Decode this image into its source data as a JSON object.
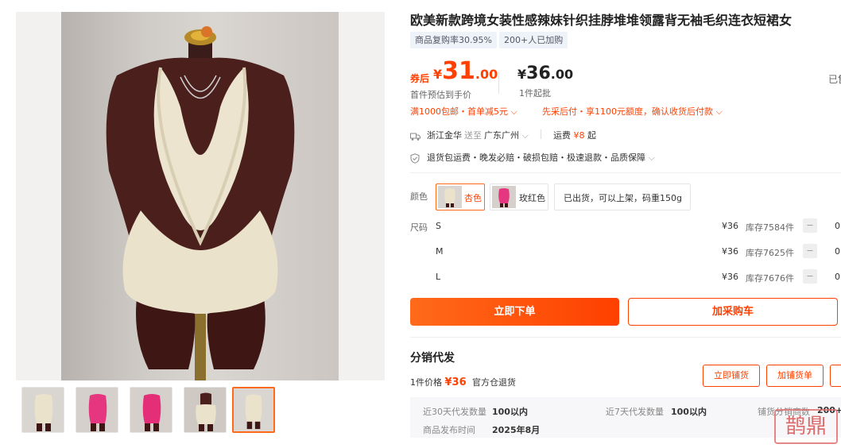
{
  "product": {
    "title": "欧美新款跨境女装性感辣妹针织挂脖堆堆领露背无袖毛织连衣短裙女",
    "tags": [
      "商品复购率30.95%",
      "200+人已加购"
    ]
  },
  "price": {
    "coupon_label": "券后",
    "coupon_sym": "¥",
    "coupon_int": "31",
    "coupon_dec": ".00",
    "coupon_note": "首件预估到手价",
    "base_sym": "¥",
    "base_int": "36",
    "base_dec": ".00",
    "base_note": "1件起批",
    "right_edge_text": "已售"
  },
  "promos": {
    "left": "满1000包邮・首单减5元",
    "right": "先采后付・享1100元额度，确认收货后付款"
  },
  "shipping": {
    "from": "浙江金华",
    "to_label": "送至",
    "to": "广东广州",
    "fee_label": "运费",
    "fee_value": "¥8",
    "fee_suffix": "起"
  },
  "guarantees": "退货包运费・晚发必赔・破损包赔・极速退款・品质保障",
  "colors": {
    "label": "颜色",
    "options": [
      "杏色",
      "玫红色"
    ],
    "note": "已出货，可以上架，码重150g"
  },
  "sizes": {
    "label": "尺码",
    "rows": [
      {
        "name": "S",
        "price": "¥36",
        "stock": "库存7584件",
        "qty": "0"
      },
      {
        "name": "M",
        "price": "¥36",
        "stock": "库存7625件",
        "qty": "0"
      },
      {
        "name": "L",
        "price": "¥36",
        "stock": "库存7676件",
        "qty": "0"
      }
    ],
    "minus": "−"
  },
  "actions": {
    "buy_now": "立即下单",
    "add_cart": "加采购车"
  },
  "distribution": {
    "heading": "分销代发",
    "unit_price_label": "1件价格",
    "unit_price": "¥36",
    "warehouse": "官方仓退货",
    "btn_list": "立即铺货",
    "btn_add": "加铺货单",
    "stats": [
      {
        "label": "近30天代发数量",
        "value": "100以内"
      },
      {
        "label": "近7天代发数量",
        "value": "100以内"
      },
      {
        "label": "铺货分销商数",
        "value": "200+"
      },
      {
        "label": "商品发布时间",
        "value": "2025年8月"
      }
    ]
  },
  "watermark_text": "鹊鼎",
  "colors_theme": {
    "accent": "#ff4000",
    "accent2": "#ff6a1a"
  }
}
